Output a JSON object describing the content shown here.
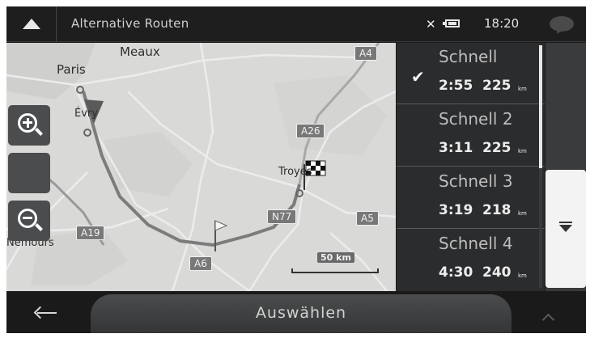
{
  "topbar": {
    "title": "Alternative Routen",
    "time": "18:20",
    "icons": {
      "back": "up-triangle-icon",
      "gps": "gps-off-icon",
      "battery": "battery-icon",
      "message": "message-bubble-icon"
    }
  },
  "map": {
    "cities": [
      "Paris",
      "Meaux",
      "Évry",
      "Troyes",
      "Nemours"
    ],
    "roads": [
      "A4",
      "A26",
      "N77",
      "A5",
      "A19",
      "A6"
    ],
    "scale": "50 km"
  },
  "routes": [
    {
      "name": "Schnell",
      "time": "2:55",
      "distance": "225",
      "unit": "km",
      "selected": true
    },
    {
      "name": "Schnell 2",
      "time": "3:11",
      "distance": "225",
      "unit": "km",
      "selected": false
    },
    {
      "name": "Schnell 3",
      "time": "3:19",
      "distance": "218",
      "unit": "km",
      "selected": false
    },
    {
      "name": "Schnell 4",
      "time": "4:30",
      "distance": "240",
      "unit": "km",
      "selected": false
    }
  ],
  "bottombar": {
    "select_label": "Auswählen"
  },
  "colors": {
    "panel": "#2b2c2d",
    "map": "#d9dad7",
    "bar": "#1a1a1a"
  }
}
